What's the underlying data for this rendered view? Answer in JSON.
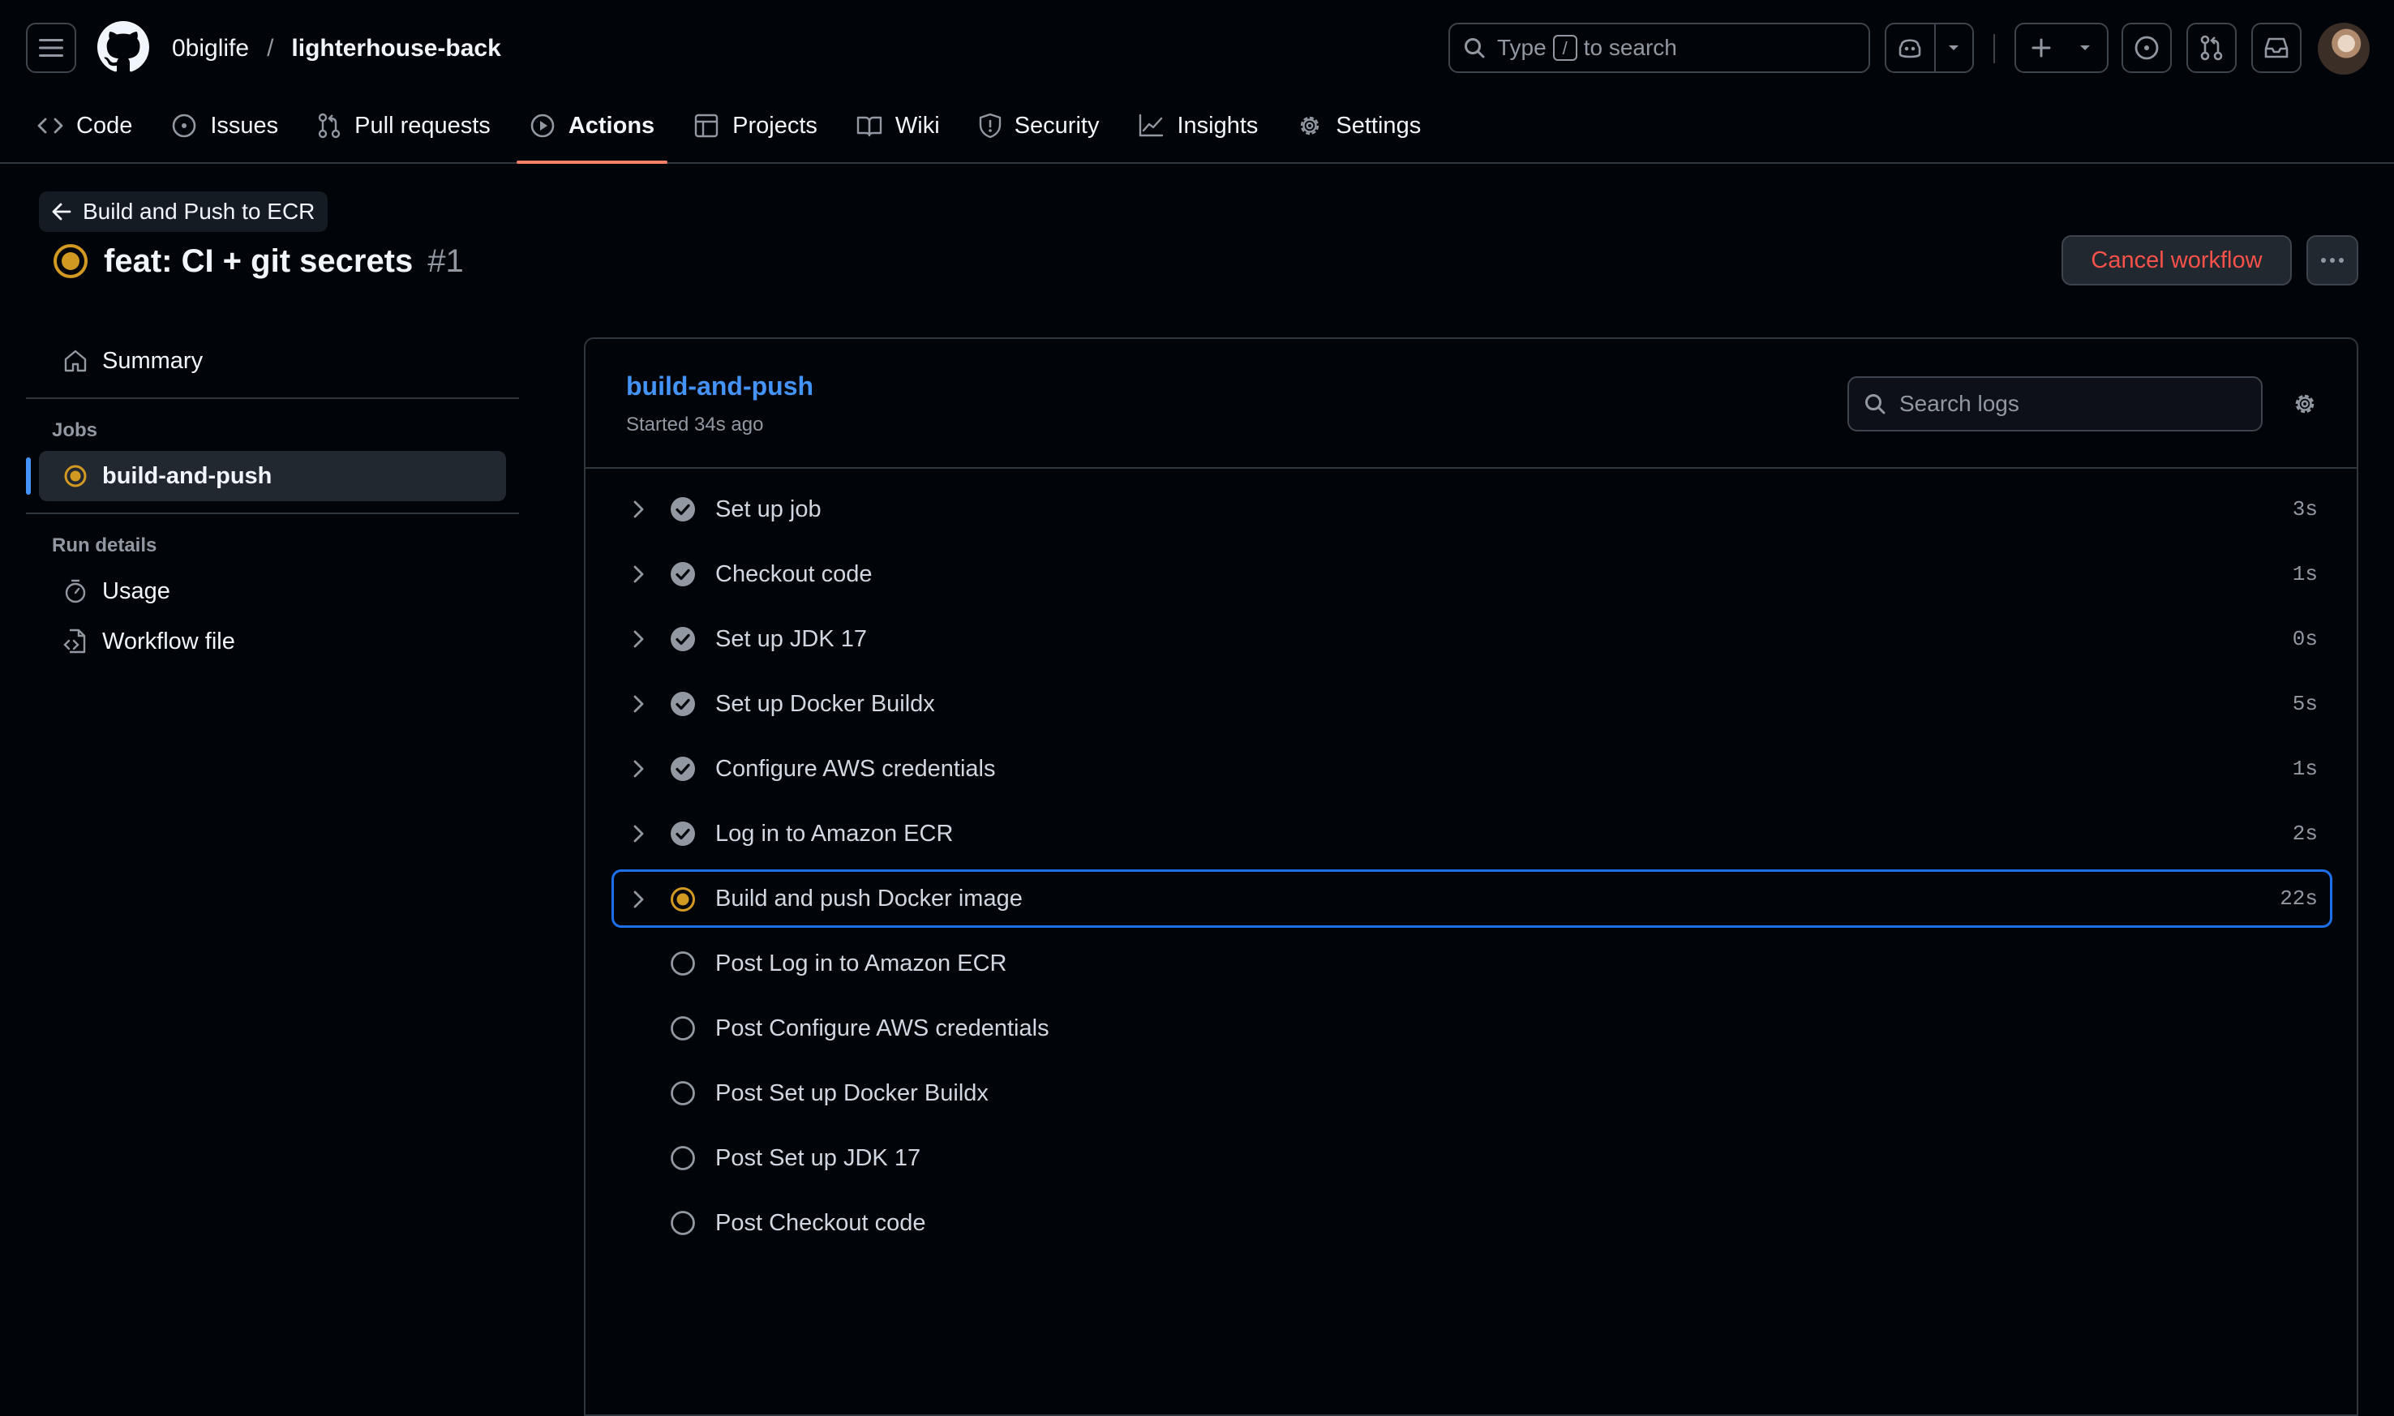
{
  "header": {
    "owner": "0biglife",
    "separator": "/",
    "repo": "lighterhouse-back",
    "search": {
      "prefix": "Type",
      "key": "/",
      "suffix": "to search"
    }
  },
  "nav": {
    "tabs": [
      {
        "label": "Code",
        "icon": "code-icon"
      },
      {
        "label": "Issues",
        "icon": "issue-icon"
      },
      {
        "label": "Pull requests",
        "icon": "pull-request-icon"
      },
      {
        "label": "Actions",
        "icon": "play-icon",
        "active": true
      },
      {
        "label": "Projects",
        "icon": "table-icon"
      },
      {
        "label": "Wiki",
        "icon": "book-icon"
      },
      {
        "label": "Security",
        "icon": "shield-icon"
      },
      {
        "label": "Insights",
        "icon": "graph-icon"
      },
      {
        "label": "Settings",
        "icon": "gear-icon"
      }
    ]
  },
  "run": {
    "back_label": "Build and Push to ECR",
    "title": "feat: CI + git secrets",
    "number": "#1",
    "cancel_label": "Cancel workflow"
  },
  "sidebar": {
    "summary": "Summary",
    "jobs_heading": "Jobs",
    "job": "build-and-push",
    "run_details_heading": "Run details",
    "usage": "Usage",
    "workflow_file": "Workflow file"
  },
  "job": {
    "name": "build-and-push",
    "started": "Started 34s ago",
    "search_placeholder": "Search logs",
    "steps": [
      {
        "name": "Set up job",
        "duration": "3s",
        "status": "success"
      },
      {
        "name": "Checkout code",
        "duration": "1s",
        "status": "success"
      },
      {
        "name": "Set up JDK 17",
        "duration": "0s",
        "status": "success"
      },
      {
        "name": "Set up Docker Buildx",
        "duration": "5s",
        "status": "success"
      },
      {
        "name": "Configure AWS credentials",
        "duration": "1s",
        "status": "success"
      },
      {
        "name": "Log in to Amazon ECR",
        "duration": "2s",
        "status": "success"
      },
      {
        "name": "Build and push Docker image",
        "duration": "22s",
        "status": "in_progress"
      },
      {
        "name": "Post Log in to Amazon ECR",
        "duration": "",
        "status": "pending"
      },
      {
        "name": "Post Configure AWS credentials",
        "duration": "",
        "status": "pending"
      },
      {
        "name": "Post Set up Docker Buildx",
        "duration": "",
        "status": "pending"
      },
      {
        "name": "Post Set up JDK 17",
        "duration": "",
        "status": "pending"
      },
      {
        "name": "Post Checkout code",
        "duration": "",
        "status": "pending"
      }
    ]
  },
  "colors": {
    "accent": "#4493f8",
    "in_progress": "#d29922",
    "danger": "#f85149",
    "tab_underline": "#f78166",
    "success_icon": "#9198a1"
  }
}
